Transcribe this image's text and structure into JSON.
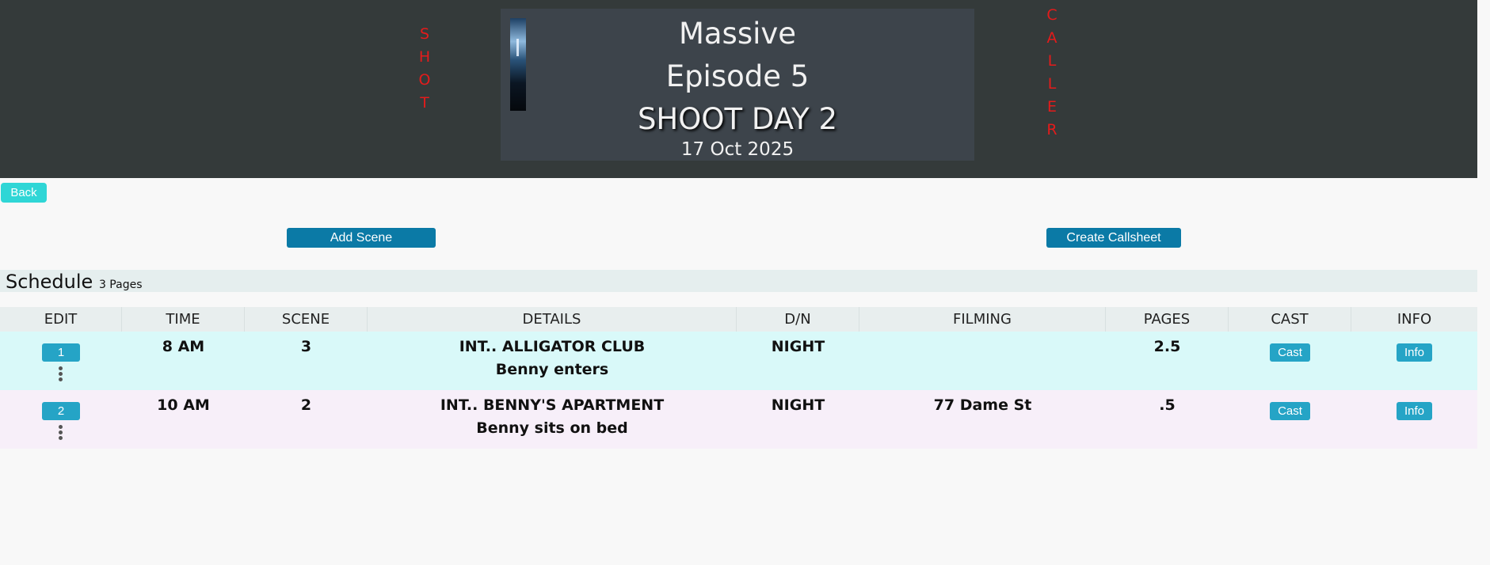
{
  "header": {
    "brand_left_letters": [
      "S",
      "H",
      "O",
      "T"
    ],
    "brand_right_letters": [
      "C",
      "A",
      "L",
      "L",
      "E",
      "R"
    ],
    "brand_color": "#e41b1b",
    "title": "Massive",
    "episode": "Episode 5",
    "shoot_day": "SHOOT DAY 2",
    "date": "17 Oct 2025"
  },
  "nav": {
    "back_label": "Back"
  },
  "actions": {
    "add_scene_label": "Add Scene",
    "create_callsheet_label": "Create Callsheet"
  },
  "schedule": {
    "title": "Schedule",
    "pages_label": "3 Pages",
    "columns": [
      "EDIT",
      "TIME",
      "SCENE",
      "DETAILS",
      "D/N",
      "FILMING",
      "PAGES",
      "CAST",
      "INFO"
    ],
    "rows": [
      {
        "edit": "1",
        "time": "8 AM",
        "scene": "3",
        "details_heading": "INT.. ALLIGATOR CLUB",
        "details_desc": "Benny enters",
        "dn": "NIGHT",
        "filming": "",
        "pages": "2.5",
        "cast_label": "Cast",
        "info_label": "Info"
      },
      {
        "edit": "2",
        "time": "10 AM",
        "scene": "2",
        "details_heading": "INT.. BENNY'S APARTMENT",
        "details_desc": "Benny sits on bed",
        "dn": "NIGHT",
        "filming": "77 Dame St",
        "pages": ".5",
        "cast_label": "Cast",
        "info_label": "Info"
      }
    ]
  },
  "colors": {
    "header_bg": "#343a3a",
    "accent": "#0b7aa6",
    "row1_bg": "#d9f9f9",
    "row2_bg": "#f7eff9"
  }
}
